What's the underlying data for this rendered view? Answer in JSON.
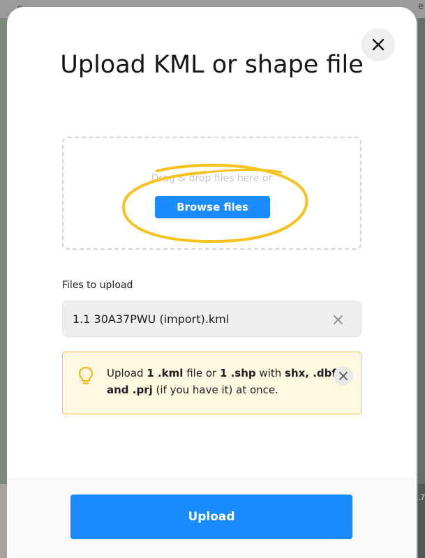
{
  "background": {
    "chevron": "«",
    "edge_text": "e",
    "right_mark": ".7"
  },
  "modal": {
    "title": "Upload KML or shape file",
    "close_icon": "close-icon"
  },
  "dropzone": {
    "hint": "Drag & drop files here or",
    "browse_label": "Browse files",
    "highlight_color": "#f7c21b"
  },
  "files": {
    "label": "Files to upload",
    "items": [
      {
        "name": "1.1 30A37PWU (import).kml"
      }
    ]
  },
  "tip": {
    "icon": "lightbulb-icon",
    "parts": {
      "p1": "Upload ",
      "b1": "1 .kml",
      "p2": " file or ",
      "b2": "1 .shp",
      "p3": " with ",
      "b3": "shx, .dbf and .prj",
      "p4": " (if you have it) at once."
    },
    "accent_color": "#f3c54d"
  },
  "footer": {
    "upload_label": "Upload"
  },
  "colors": {
    "primary": "#1a8cff",
    "tip_bg": "#fff8e1"
  }
}
